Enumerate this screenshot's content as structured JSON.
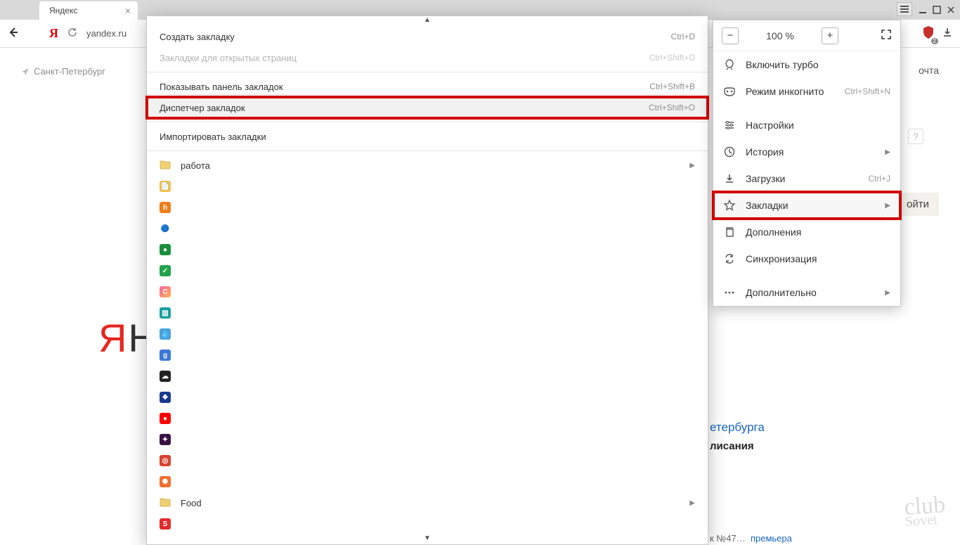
{
  "tab": {
    "title": "Яндекс"
  },
  "address": {
    "url": "yandex.ru"
  },
  "page": {
    "geo": "Санкт-Петербург",
    "logo_first": "Я",
    "logo_rest": "НДЕ",
    "mail": "очта",
    "help": "?",
    "enter": "ойти",
    "link": "етербурга",
    "sub": "лисания",
    "bottom_prefix": "к №47…",
    "bottom_link": "премьера"
  },
  "zoom": {
    "value": "100 %"
  },
  "menu": {
    "items": [
      {
        "icon": "rocket",
        "label": "Включить турбо",
        "short": "",
        "arrow": false
      },
      {
        "icon": "mask",
        "label": "Режим инкогнито",
        "short": "Ctrl+Shift+N",
        "arrow": false
      },
      {
        "sep": true
      },
      {
        "icon": "sliders",
        "label": "Настройки",
        "short": "",
        "arrow": false
      },
      {
        "icon": "clock",
        "label": "История",
        "short": "",
        "arrow": true
      },
      {
        "icon": "download",
        "label": "Загрузки",
        "short": "Ctrl+J",
        "arrow": false
      },
      {
        "icon": "star",
        "label": "Закладки",
        "short": "",
        "arrow": true,
        "hl": true
      },
      {
        "icon": "copy",
        "label": "Дополнения",
        "short": "",
        "arrow": false
      },
      {
        "icon": "sync",
        "label": "Синхронизация",
        "short": "",
        "arrow": false
      },
      {
        "sep": true
      },
      {
        "icon": "dots",
        "label": "Дополнительно",
        "short": "",
        "arrow": true
      }
    ]
  },
  "submenu": {
    "top": [
      {
        "label": "Создать закладку",
        "short": "Ctrl+D"
      },
      {
        "label": "Закладки для открытых страниц",
        "short": "Ctrl+Shift+D",
        "disabled": true
      },
      {
        "sep": true
      },
      {
        "label": "Показывать панель закладок",
        "short": "Ctrl+Shift+B"
      },
      {
        "label": "Диспетчер закладок",
        "short": "Ctrl+Shift+O",
        "hl": true
      },
      {
        "sep": true
      },
      {
        "label": "Импортировать закладки",
        "short": ""
      }
    ],
    "bookmarks": [
      {
        "type": "folder",
        "label": "работа",
        "arrow": true
      },
      {
        "type": "fav",
        "bg": "#f3c04b",
        "ch": "📄"
      },
      {
        "type": "fav",
        "bg": "#ef7f1a",
        "ch": "h"
      },
      {
        "type": "fav",
        "bg": "#ffffff",
        "ch": "🔵"
      },
      {
        "type": "fav",
        "bg": "#1a8f3b",
        "ch": "●"
      },
      {
        "type": "fav",
        "bg": "#22a24c",
        "ch": "✓"
      },
      {
        "type": "fav",
        "bg": "linear-gradient(135deg,#ff5ea0,#ffb64d)",
        "ch": "C"
      },
      {
        "type": "fav",
        "bg": "#1aa0a0",
        "ch": "▥"
      },
      {
        "type": "fav",
        "bg": "#4aa3df",
        "ch": "💧"
      },
      {
        "type": "fav",
        "bg": "#3b78d8",
        "ch": "g"
      },
      {
        "type": "fav",
        "bg": "#222",
        "ch": "☁"
      },
      {
        "type": "fav",
        "bg": "#1a3a8f",
        "ch": "❖"
      },
      {
        "type": "fav",
        "bg": "#ff0000",
        "ch": "●"
      },
      {
        "type": "fav",
        "bg": "#3a1044",
        "ch": "✦"
      },
      {
        "type": "fav",
        "bg": "#d8432e",
        "ch": "◎"
      },
      {
        "type": "fav",
        "bg": "#f07030",
        "ch": "✺"
      },
      {
        "type": "folder",
        "label": "Food",
        "arrow": true
      },
      {
        "type": "fav",
        "bg": "#e22b2b",
        "ch": "S"
      }
    ]
  },
  "watermark": {
    "line1": "club",
    "line2": "Sovet"
  }
}
